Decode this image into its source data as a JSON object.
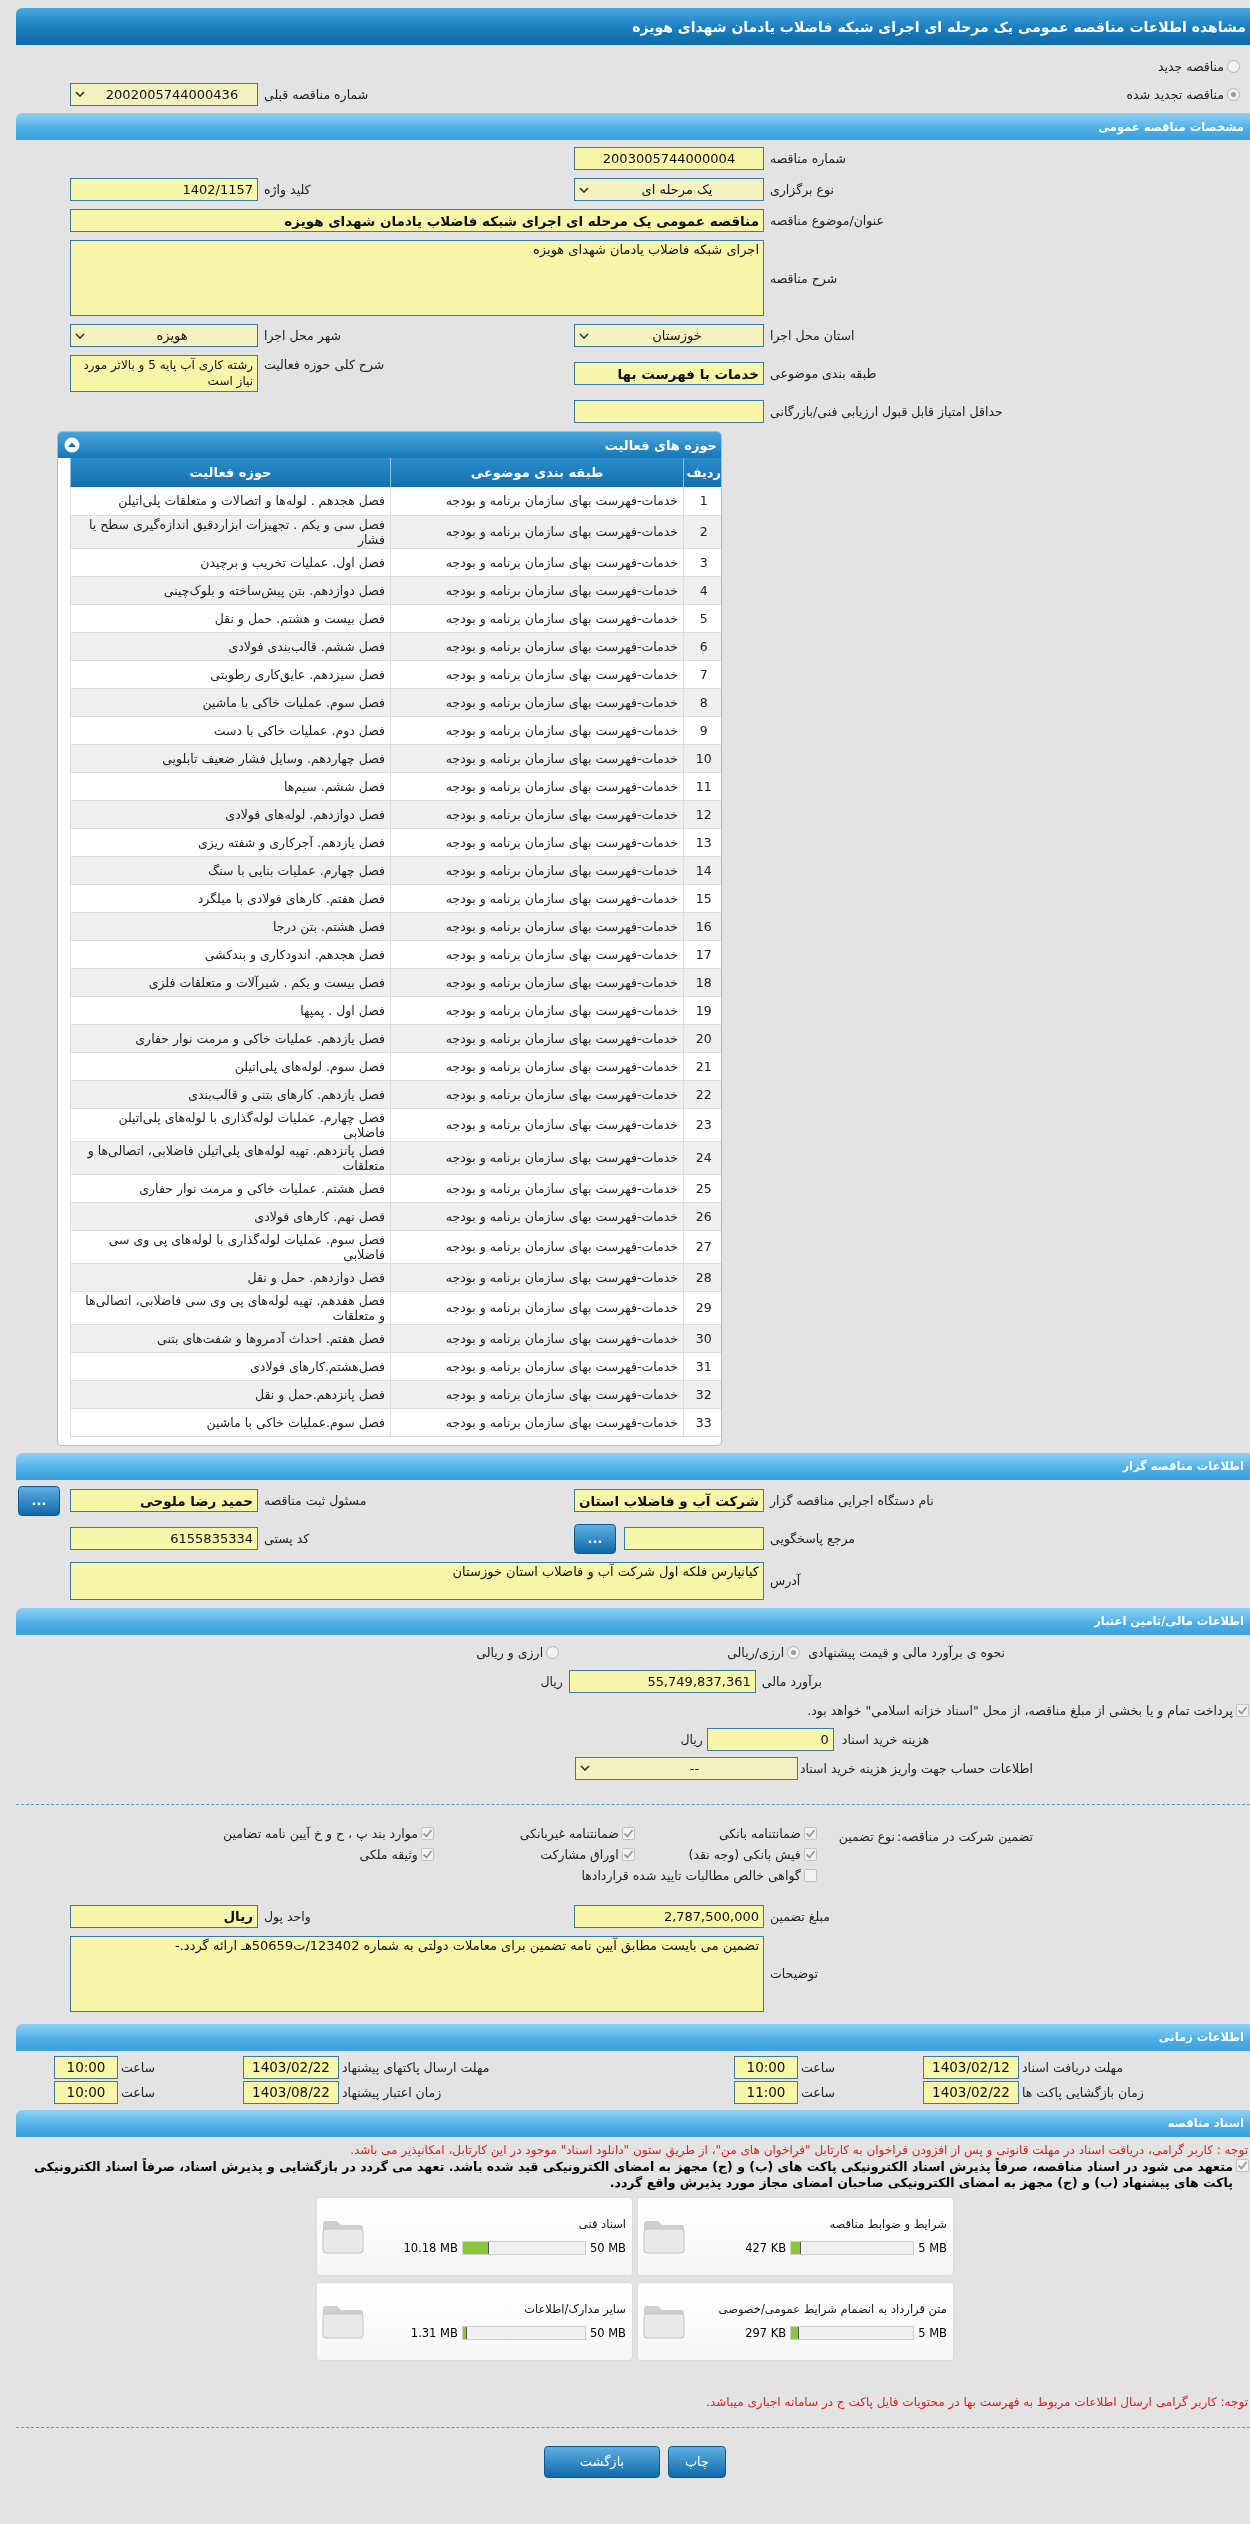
{
  "title": "مشاهده اطلاعات مناقصه عمومی یک مرحله ای اجرای شبکه فاضلاب یادمان شهدای هویزه",
  "tender_kind": {
    "options": [
      {
        "label": "مناقصه جدید",
        "selected": false
      },
      {
        "label": "مناقصه تجدید شده",
        "selected": true
      }
    ],
    "previous": {
      "label": "شماره مناقصه قبلی",
      "value": "2002005744000436",
      "kind": "select"
    }
  },
  "general": {
    "header": "مشخصات مناقصه عمومی",
    "rows": [
      {
        "right": {
          "label": "شماره مناقصه",
          "value": "2003005744000004",
          "kind": "center"
        }
      },
      {
        "right": {
          "label": "نوع برگزاری",
          "value": "یک مرحله ای",
          "kind": "select"
        },
        "left": {
          "label": "کلید واژه",
          "value": "1402/1157",
          "kind": "text"
        }
      },
      {
        "wide": {
          "label": "عنوان/موضوع مناقصه",
          "value": "مناقصه عمومی یک مرحله ای اجرای شبکه فاضلاب یادمان شهدای هویزه",
          "kind": "big"
        }
      },
      {
        "wide": {
          "label": "شرح مناقصه",
          "value": "اجرای شبکه فاضلاب یادمان شهدای هویزه",
          "kind": "area"
        }
      },
      {
        "right": {
          "label": "استان محل اجرا",
          "value": "خوزستان",
          "kind": "select"
        },
        "left": {
          "label": "شهر محل اجرا",
          "value": "هویزه",
          "kind": "select"
        }
      },
      {
        "right": {
          "label": "طبقه بندی موضوعی",
          "value": "خدمات با فهرست بها",
          "kind": "big"
        },
        "left": {
          "label": "شرح کلی حوزه فعالیت",
          "value": "رشته کاری آب پایه 5 و بالاتر مورد نیاز است",
          "kind": "note"
        }
      },
      {
        "right": {
          "label": "حداقل امتیاز قابل قبول ارزیابی فنی/بازرگانی",
          "kind": "text"
        }
      }
    ]
  },
  "activities": {
    "header": "حوزه های فعالیت",
    "columns": [
      "ردیف",
      "طبقه بندی موضوعی",
      "حوزه فعالیت"
    ],
    "rows": [
      [
        "1",
        "خدمات-فهرست بهای سازمان برنامه و بودجه",
        "فصل هجدهم . لوله‌ها و اتصالات و متعلقات پلی‌اتیلن"
      ],
      [
        "2",
        "خدمات-فهرست بهای سازمان برنامه و بودجه",
        "فصل سی و یکم . تجهیزات ابزاردقیق اندازه‌گیری سطح یا فشار"
      ],
      [
        "3",
        "خدمات-فهرست بهای سازمان برنامه و بودجه",
        "فصل اول. عملیات تخریب و برچیدن"
      ],
      [
        "4",
        "خدمات-فهرست بهای سازمان برنامه و بودجه",
        "فصل دوازدهم. بتن پیش‌ساخته و بلوک‌چینی"
      ],
      [
        "5",
        "خدمات-فهرست بهای سازمان برنامه و بودجه",
        "فصل بیست و هشتم. حمل و نقل"
      ],
      [
        "6",
        "خدمات-فهرست بهای سازمان برنامه و بودجه",
        "فصل ششم. قالب‌بندی فولادی"
      ],
      [
        "7",
        "خدمات-فهرست بهای سازمان برنامه و بودجه",
        "فصل سیزدهم. عایق‌کاری رطوبتی"
      ],
      [
        "8",
        "خدمات-فهرست بهای سازمان برنامه و بودجه",
        "فصل سوم. عملیات خاکی با ماشین"
      ],
      [
        "9",
        "خدمات-فهرست بهای سازمان برنامه و بودجه",
        "فصل دوم. عملیات خاکی با دست"
      ],
      [
        "10",
        "خدمات-فهرست بهای سازمان برنامه و بودجه",
        "فصل چهاردهم. وسایل فشار ضعیف تابلویی"
      ],
      [
        "11",
        "خدمات-فهرست بهای سازمان برنامه و بودجه",
        "فصل ششم. سیم‌ها"
      ],
      [
        "12",
        "خدمات-فهرست بهای سازمان برنامه و بودجه",
        "فصل دوازدهم. لوله‌های فولادی"
      ],
      [
        "13",
        "خدمات-فهرست بهای سازمان برنامه و بودجه",
        "فصل یازدهم. آجرکاری و شفته ریزی"
      ],
      [
        "14",
        "خدمات-فهرست بهای سازمان برنامه و بودجه",
        "فصل چهارم. عملیات بنایی با سنگ"
      ],
      [
        "15",
        "خدمات-فهرست بهای سازمان برنامه و بودجه",
        "فصل هفتم. کارهای فولادی با میلگرد"
      ],
      [
        "16",
        "خدمات-فهرست بهای سازمان برنامه و بودجه",
        "فصل هشتم. بتن درجا"
      ],
      [
        "17",
        "خدمات-فهرست بهای سازمان برنامه و بودجه",
        "فصل هجدهم. اندودکاری و بندکشی"
      ],
      [
        "18",
        "خدمات-فهرست بهای سازمان برنامه و بودجه",
        "فصل بیست و یکم . شیرآلات و متعلقات فلزی"
      ],
      [
        "19",
        "خدمات-فهرست بهای سازمان برنامه و بودجه",
        "فصل اول . پمپها"
      ],
      [
        "20",
        "خدمات-فهرست بهای سازمان برنامه و بودجه",
        "فصل یازدهم. عملیات خاکی و مرمت نوار حفاری"
      ],
      [
        "21",
        "خدمات-فهرست بهای سازمان برنامه و بودجه",
        "فصل سوم. لوله‌های پلی‌اتیلن"
      ],
      [
        "22",
        "خدمات-فهرست بهای سازمان برنامه و بودجه",
        "فصل یازدهم. کارهای بتنی و قالب‌بندی"
      ],
      [
        "23",
        "خدمات-فهرست بهای سازمان برنامه و بودجه",
        "فصل چهارم. عملیات لوله‌گذاری با لوله‌های پلی‌اتیلن فاضلابی"
      ],
      [
        "24",
        "خدمات-فهرست بهای سازمان برنامه و بودجه",
        "فصل پانزدهم. تهیه لوله‌های پلی‌اتیلن فاضلابی، اتصالی‌ها و متعلقات"
      ],
      [
        "25",
        "خدمات-فهرست بهای سازمان برنامه و بودجه",
        "فصل هشتم. عملیات خاکی و مرمت نوار حفاری"
      ],
      [
        "26",
        "خدمات-فهرست بهای سازمان برنامه و بودجه",
        "فصل نهم. کارهای فولادی"
      ],
      [
        "27",
        "خدمات-فهرست بهای سازمان برنامه و بودجه",
        "فصل سوم. عملیات لوله‌گذاری با لوله‌های پی وی سی فاضلابی"
      ],
      [
        "28",
        "خدمات-فهرست بهای سازمان برنامه و بودجه",
        "فصل دوازدهم. حمل و نقل"
      ],
      [
        "29",
        "خدمات-فهرست بهای سازمان برنامه و بودجه",
        "فصل هفدهم. تهیه لوله‌های پی وی سی فاضلابی، اتصالی‌ها و متعلقات"
      ],
      [
        "30",
        "خدمات-فهرست بهای سازمان برنامه و بودجه",
        "فصل هفتم. احداث آدمروها و شفت‌های بتنی"
      ],
      [
        "31",
        "خدمات-فهرست بهای سازمان برنامه و بودجه",
        "فصل‌هشتم.کارهای فولادی"
      ],
      [
        "32",
        "خدمات-فهرست بهای سازمان برنامه و بودجه",
        "فصل پانزدهم.حمل و نقل"
      ],
      [
        "33",
        "خدمات-فهرست بهای سازمان برنامه و بودجه",
        "فصل سوم.عملیات خاکی با ماشین"
      ]
    ]
  },
  "contractor": {
    "header": "اطلاعات مناقصه گزار",
    "rows": [
      {
        "right": {
          "label": "نام دستگاه اجرایی مناقصه گزار",
          "value": "شرکت آب و فاضلاب استان",
          "kind": "big"
        },
        "left": {
          "label": "مسئول ثبت مناقصه",
          "value": "حمید رضا ملوحی",
          "kind": "big",
          "button": "..."
        }
      },
      {
        "right": {
          "label": "مرجع پاسخگویی",
          "kind": "text",
          "button": "..."
        },
        "left": {
          "label": "کد پستی",
          "value": "6155835334",
          "kind": "text"
        }
      },
      {
        "wide": {
          "label": "آدرس",
          "value": "کیانپارس فلکه اول شرکت آب و فاضلاب استان خوزستان",
          "kind": "address"
        }
      }
    ]
  },
  "finance": {
    "header": "اطلاعات مالی/تامین اعتبار",
    "method": {
      "label": "نحوه ی برآورد مالی و قیمت پیشنهادی",
      "options": [
        {
          "label": "ارزی/ریالی",
          "selected": true
        },
        {
          "label": "ارزی و ریالی",
          "selected": false
        }
      ]
    },
    "estimate": {
      "label": "برآورد مالی",
      "value": "55,749,837,361",
      "unit": "ریال"
    },
    "treasury": {
      "label": "پرداخت تمام و یا بخشی از مبلغ مناقصه، از محل \"اسناد خزانه اسلامی\" خواهد بود.",
      "checked": true
    },
    "doc_fee": {
      "label": "هزینه خرید اسناد",
      "value": "0",
      "unit": "ریال"
    },
    "account": {
      "label": "اطلاعات حساب جهت واریز هزینه خرید اسناد",
      "value": "--"
    }
  },
  "guarantee": {
    "label": "تضمین شرکت در مناقصه:",
    "type_label": "نوع تضمین",
    "options": [
      {
        "label": "ضمانتنامه بانکی",
        "checked": true
      },
      {
        "label": "ضمانتنامه غیربانکی",
        "checked": true
      },
      {
        "label": "موارد بند پ ، ح و خ آیین نامه تضامین",
        "checked": true
      },
      {
        "label": "فیش بانکی (وجه نقد)",
        "checked": true
      },
      {
        "label": "اوراق مشارکت",
        "checked": true
      },
      {
        "label": "وثیقه ملکی",
        "checked": true
      },
      {
        "label": "گواهی خالص مطالبات تایید شده قراردادها",
        "checked": false
      }
    ],
    "rows": [
      {
        "right": {
          "label": "مبلغ تضمین",
          "value": "2,787,500,000",
          "kind": "text"
        },
        "left": {
          "label": "واحد پول",
          "value": "ریال",
          "kind": "big"
        }
      },
      {
        "wide": {
          "label": "توضیحات",
          "value": "تضمین می بایست مطابق آیین نامه تضمین برای معاملات دولتی به شماره 123402/ت50659هـ ارائه گردد.-",
          "kind": "area"
        }
      }
    ]
  },
  "timing": {
    "header": "اطلاعات زمانی",
    "items": [
      {
        "label": "مهلت دریافت اسناد",
        "date": "1403/02/12",
        "hour_label": "ساعت",
        "time": "10:00"
      },
      {
        "label": "مهلت ارسال پاکتهای پیشنهاد",
        "date": "1403/02/22",
        "hour_label": "ساعت",
        "time": "10:00"
      },
      {
        "label": "زمان بازگشایی پاکت ها",
        "date": "1403/02/22",
        "hour_label": "ساعت",
        "time": "11:00"
      },
      {
        "label": "زمان اعتبار پیشنهاد",
        "date": "1403/08/22",
        "hour_label": "ساعت",
        "time": "10:00"
      }
    ]
  },
  "documents": {
    "header": "اسناد مناقصه",
    "notice": "توجه : کاربر گرامی، دریافت اسناد در مهلت قانونی و پس از افزودن فراخوان به کارتابل \"فراخوان های من\"، از طریق ستون \"دانلود اسناد\" موجود در این کارتابل، امکانپذیر می باشد.",
    "pledge": {
      "text": "متعهد می شود در اسناد مناقصه، صرفاً پذیرش اسناد الکترونیکی پاکت های (ب) و (ج) مجهز به امضای الکترونیکی قید شده باشد. تعهد می گردد در بازگشایی و پذیرش اسناد، صرفاً اسناد الکترونیکی پاکت های پیشنهاد (ب) و (ج) مجهز به امضای الکترونیکی صاحبان امضای مجاز مورد پذیرش واقع گردد.",
      "checked": true
    },
    "files": [
      {
        "title": "شرایط و ضوابط مناقصه",
        "size": "427 KB",
        "limit": "5 MB",
        "level": 0.08
      },
      {
        "title": "اسناد فنی",
        "size": "10.18 MB",
        "limit": "50 MB",
        "level": 0.21
      },
      {
        "title": "متن قرارداد به انضمام شرایط عمومی/خصوصی",
        "size": "297 KB",
        "limit": "5 MB",
        "level": 0.06
      },
      {
        "title": "سایر مدارک/اطلاعات",
        "size": "1.31 MB",
        "limit": "50 MB",
        "level": 0.03
      }
    ],
    "footnote": "توجه: کاربر گرامی ارسال اطلاعات مربوط به فهرست بها در محتویات فایل پاکت ج در سامانه اجباری میباشد."
  },
  "actions": [
    "چاپ",
    "بازگشت"
  ]
}
